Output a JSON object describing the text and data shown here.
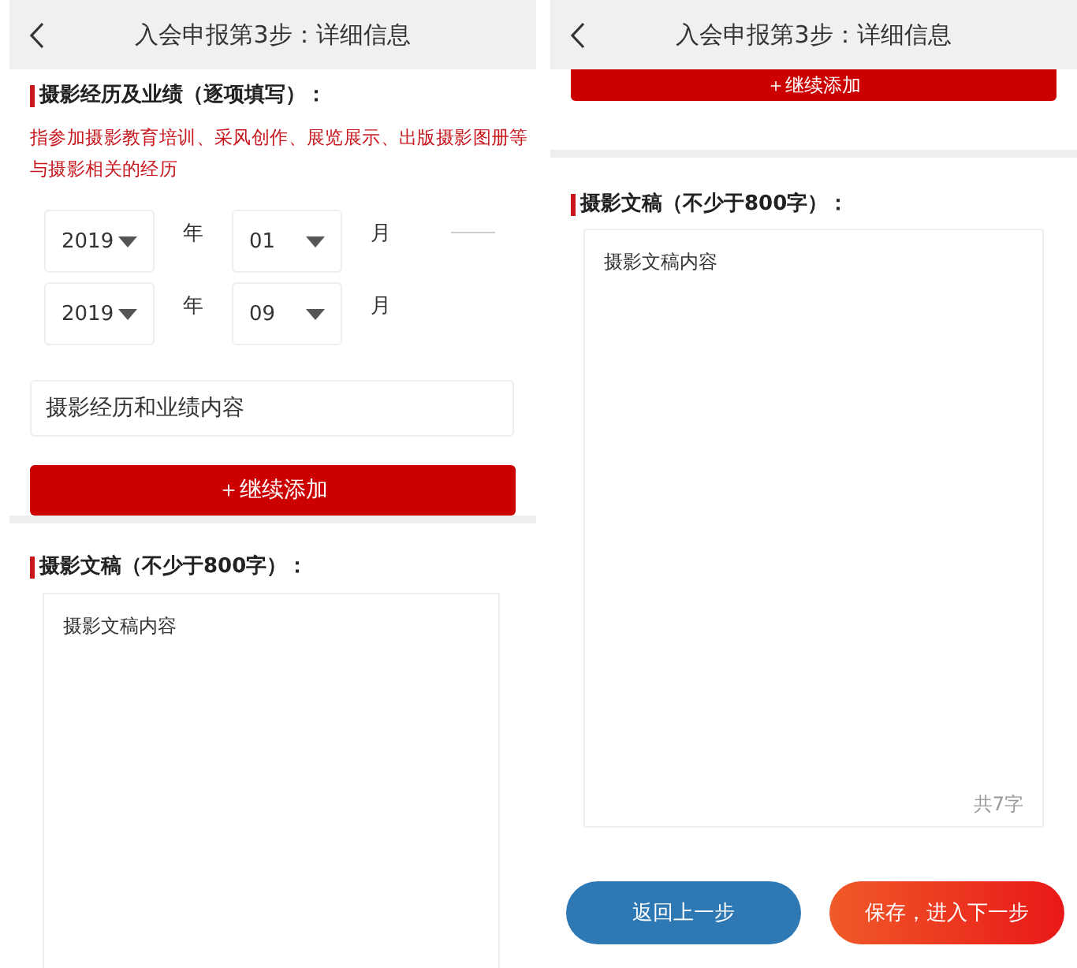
{
  "screens": [
    {
      "title": "入会申报第3步：详细信息",
      "experience": {
        "heading": "摄影经历及业绩（逐项填写）：",
        "hint": "指参加摄影教育培训、采风创作、展览展示、出版摄影图册等与摄影相关的经历",
        "date_rows": [
          {
            "year": "2019",
            "year_unit": "年",
            "month": "01",
            "month_unit": "月",
            "separator": true
          },
          {
            "year": "2019",
            "year_unit": "年",
            "month": "09",
            "month_unit": "月",
            "separator": false
          }
        ],
        "content_value": "摄影经历和业绩内容",
        "add_button": "＋继续添加"
      },
      "essay": {
        "heading": "摄影文稿（不少于800字）：",
        "value": "摄影文稿内容"
      }
    },
    {
      "title": "入会申报第3步：详细信息",
      "add_button": "＋继续添加",
      "essay": {
        "heading": "摄影文稿（不少于800字）：",
        "value": "摄影文稿内容",
        "counter": "共7字"
      },
      "buttons": [
        {
          "label": "返回上一步",
          "kind": "back"
        },
        {
          "label": "保存，进入下一步",
          "kind": "next"
        }
      ]
    }
  ]
}
